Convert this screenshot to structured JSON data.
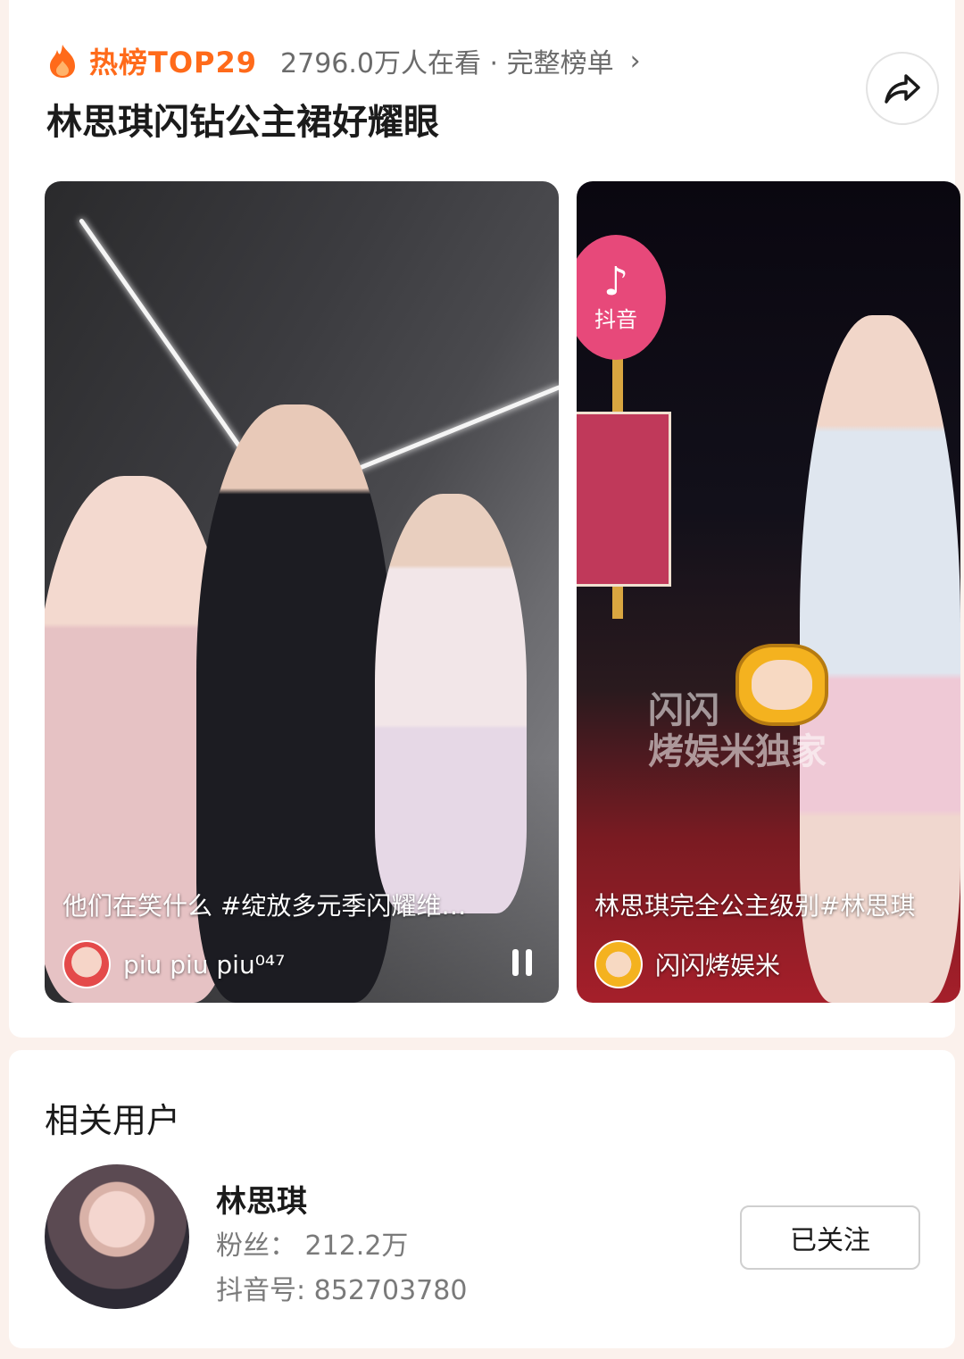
{
  "hot": {
    "rank_label": "热榜TOP29",
    "watch_text": "2796.0万人在看 · 完整榜单",
    "chevron": "›",
    "topic_title": "林思琪闪钻公主裙好耀眼",
    "rank_color": "#ff6a1a"
  },
  "videos": [
    {
      "caption": "他们在笑什么 #绽放多元季闪耀维…",
      "author": "piu piu piu⁰⁴⁷",
      "playing": true
    },
    {
      "caption": "林思琪完全公主级别#林思琪",
      "author": "闪闪烤娱米",
      "sign_text": "抖音",
      "watermark_line1": "闪闪",
      "watermark_line2": "烤娱米独家"
    }
  ],
  "related": {
    "title": "相关用户",
    "user": {
      "name": "林思琪",
      "fans": "粉丝： 212.2万",
      "douyin_id": "抖音号: 852703780",
      "follow_label": "已关注"
    }
  }
}
